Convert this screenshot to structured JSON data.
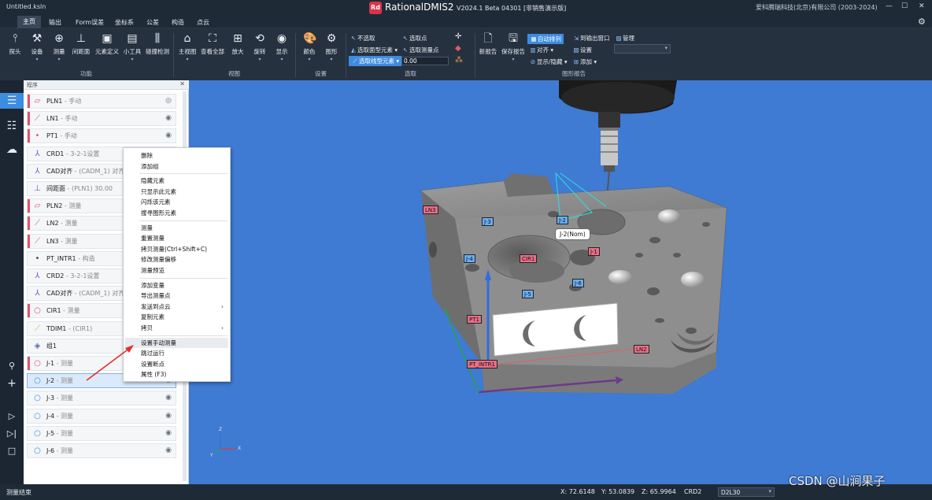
{
  "app": {
    "doc_title": "Untitled.ksln",
    "logo_text": "Rd",
    "name": "RationalDMIS2",
    "version": "V2024.1 Beta 04301 [非销售演示版]",
    "company": "爱科腾瑞科技(北京)有限公司 (2003-2024)"
  },
  "window": {
    "min": "—",
    "max": "☐",
    "close": "✕"
  },
  "menu": {
    "items": [
      "主页",
      "输出",
      "Form误差",
      "坐标系",
      "公差",
      "构造",
      "点云"
    ],
    "settings_icon": "gear-icon"
  },
  "ribbon": {
    "func_buttons": [
      "探头",
      "设备",
      "测量",
      "间距面",
      "元素定义",
      "小工具",
      "碰撞检测"
    ],
    "view_buttons": [
      "主视图",
      "查看全部",
      "放大",
      "旋转",
      "显示"
    ],
    "setting_buttons": [
      "颜色",
      "图形"
    ],
    "groups": {
      "func": "功能",
      "view": "视图",
      "setting": "设置",
      "select": "选取",
      "report": "图形报告"
    },
    "select": {
      "no_select": "不选取",
      "select_face": "选取面型元素",
      "select_line": "选取线型元素",
      "select_point": "选取点",
      "select_meas": "选取测量点",
      "tolerance": "0.00"
    },
    "report": {
      "new": "新报告",
      "save": "保存报告",
      "auto_arrange": "自动排列",
      "align": "对齐",
      "show_hide": "显示/隐藏",
      "to_output": "到输出窗口",
      "setup": "设置",
      "add": "添加",
      "manage": "管理"
    }
  },
  "panel": {
    "title": "程序",
    "items": [
      {
        "name": "PLN1",
        "status": " - 手动",
        "icon": "plane-icon",
        "color": "#e0536c"
      },
      {
        "name": "LN1",
        "status": " - 手动",
        "icon": "line-icon",
        "color": "#e0536c"
      },
      {
        "name": "PT1",
        "status": " - 手动",
        "icon": "point-icon",
        "color": "#e0536c"
      },
      {
        "name": "CRD1",
        "status": " - 3-2-1设置",
        "icon": "coordinate-icon",
        "color": "#8a52c9"
      },
      {
        "name": "CAD对齐",
        "status": " - (CADM_1) 对齐",
        "icon": "cad-align-icon",
        "color": "#8a52c9"
      },
      {
        "name": "间距面",
        "status": " - (PLN1) 30.00",
        "icon": "distance-plane-icon",
        "color": "#8a52c9"
      },
      {
        "name": "PLN2",
        "status": " - 测量",
        "icon": "plane-icon",
        "color": "#e0536c"
      },
      {
        "name": "LN2",
        "status": " - 测量",
        "icon": "line-icon",
        "color": "#e0536c"
      },
      {
        "name": "LN3",
        "status": " - 测量",
        "icon": "line-icon",
        "color": "#e0536c"
      },
      {
        "name": "PT_INTR1",
        "status": " - 构造",
        "icon": "point-icon",
        "color": "#444444"
      },
      {
        "name": "CRD2",
        "status": " - 3-2-1设置",
        "icon": "coordinate-icon",
        "color": "#8a52c9"
      },
      {
        "name": "CAD对齐",
        "status": " - (CADM_1) 对齐",
        "icon": "cad-align-icon",
        "color": "#8a52c9"
      },
      {
        "name": "CIR1",
        "status": " - 测量",
        "icon": "circle-icon",
        "color": "#e0536c"
      },
      {
        "name": "TDIM1",
        "status": " - (CIR1)",
        "icon": "ruler-icon",
        "color": "#e0a33a"
      },
      {
        "name": "组1",
        "status": "",
        "icon": "group-icon",
        "color": "#5a6fa8"
      },
      {
        "name": "J-1",
        "status": " - 测量",
        "icon": "circle-icon",
        "color": "#e0536c"
      },
      {
        "name": "J-2",
        "status": " - 测量",
        "icon": "circle-icon",
        "color": "#3a8ee0"
      },
      {
        "name": "J-3",
        "status": " - 测量",
        "icon": "circle-icon",
        "color": "#3a8ee0"
      },
      {
        "name": "J-4",
        "status": " - 测量",
        "icon": "circle-icon",
        "color": "#3a8ee0"
      },
      {
        "name": "J-5",
        "status": " - 测量",
        "icon": "circle-icon",
        "color": "#3a8ee0"
      },
      {
        "name": "J-6",
        "status": " - 测量",
        "icon": "circle-icon",
        "color": "#3a8ee0"
      }
    ]
  },
  "context_menu": {
    "items": [
      "删除",
      "添加组",
      "隐藏元素",
      "只显示此元素",
      "闪烁该元素",
      "搜寻图形元素",
      "测量",
      "重置测量",
      "拷贝测量(Ctrl+Shift+C)",
      "修改测量偏移",
      "测量预览",
      "添加变量",
      "导出测量点",
      "发送到点云",
      "复制元素",
      "拷贝",
      "设置手动测量",
      "跳过运行",
      "设置断点",
      "属性 (F3)"
    ]
  },
  "viewport": {
    "labels": [
      {
        "text": "LN3",
        "style": "r"
      },
      {
        "text": "J-3",
        "style": "b"
      },
      {
        "text": "J-2",
        "style": "b"
      },
      {
        "text": "J-4",
        "style": "b"
      },
      {
        "text": "CIR1",
        "style": "r"
      },
      {
        "text": "J-1",
        "style": "r"
      },
      {
        "text": "J-6",
        "style": "b"
      },
      {
        "text": "J-5",
        "style": "b"
      },
      {
        "text": "PT1",
        "style": "r"
      },
      {
        "text": "PT_INTR1",
        "style": "r"
      },
      {
        "text": "LN2",
        "style": "r"
      }
    ],
    "tooltip": "J-2(Nom)",
    "axis": {
      "x": "X",
      "y": "Y",
      "z": "Z"
    }
  },
  "status": {
    "left": "测量结束",
    "x": "X: 72.6148",
    "y": "Y: 53.0839",
    "z": "Z: 65.9964",
    "crd": "CRD2",
    "dropdown": "D2L30",
    "watermark": "CSDN @山涧果子"
  }
}
